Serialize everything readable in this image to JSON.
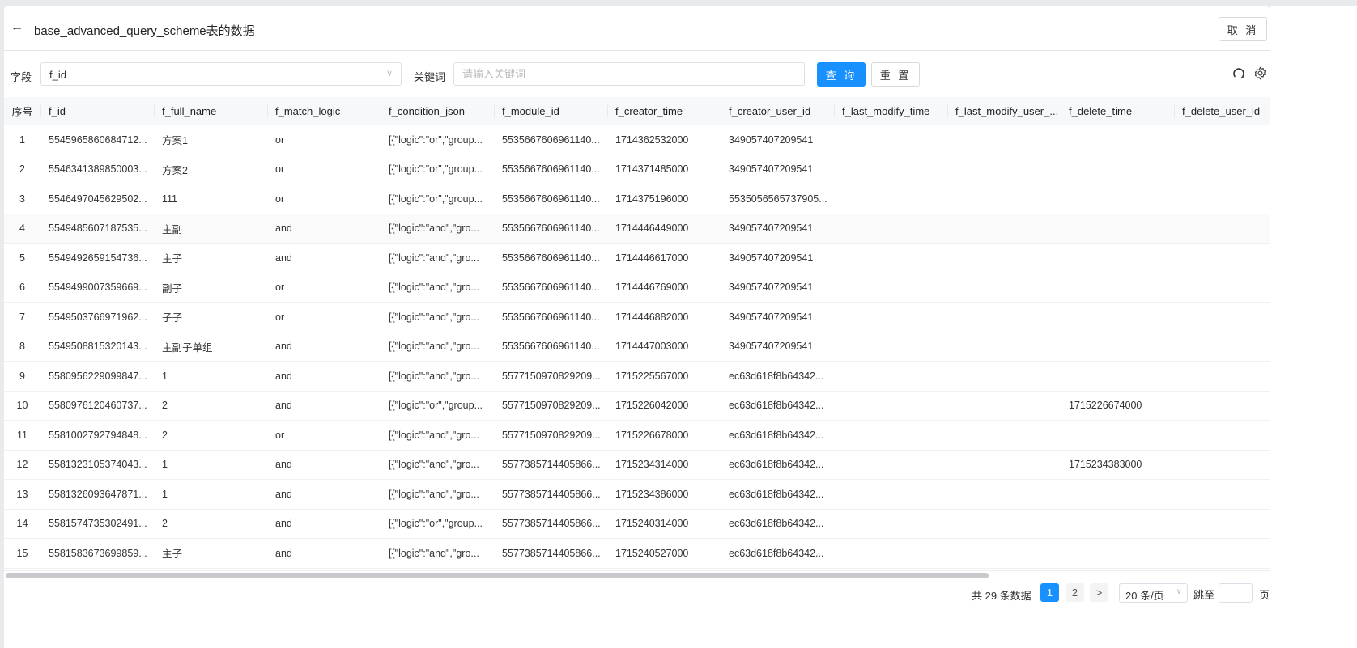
{
  "header": {
    "title": "base_advanced_query_scheme表的数据",
    "cancel_label": "取 消"
  },
  "filter": {
    "field_label": "字段",
    "field_value": "f_id",
    "keyword_label": "关键词",
    "keyword_placeholder": "请输入关键词",
    "keyword_value": "",
    "query_label": "查 询",
    "reset_label": "重 置"
  },
  "colors": {
    "primary": "#1890ff",
    "header_bg": "#f7f8fa"
  },
  "table": {
    "columns": [
      "序号",
      "f_id",
      "f_full_name",
      "f_match_logic",
      "f_condition_json",
      "f_module_id",
      "f_creator_time",
      "f_creator_user_id",
      "f_last_modify_time",
      "f_last_modify_user_...",
      "f_delete_time",
      "f_delete_user_id"
    ],
    "rows": [
      [
        "1",
        "5545965860684712...",
        "方案1",
        "or",
        "[{\"logic\":\"or\",\"group...",
        "5535667606961140...",
        "1714362532000",
        "349057407209541",
        "",
        "",
        "",
        ""
      ],
      [
        "2",
        "5546341389850003...",
        "方案2",
        "or",
        "[{\"logic\":\"or\",\"group...",
        "5535667606961140...",
        "1714371485000",
        "349057407209541",
        "",
        "",
        "",
        ""
      ],
      [
        "3",
        "5546497045629502...",
        "111",
        "or",
        "[{\"logic\":\"or\",\"group...",
        "5535667606961140...",
        "1714375196000",
        "5535056565737905...",
        "",
        "",
        "",
        ""
      ],
      [
        "4",
        "5549485607187535...",
        "主副",
        "and",
        "[{\"logic\":\"and\",\"gro...",
        "5535667606961140...",
        "1714446449000",
        "349057407209541",
        "",
        "",
        "",
        ""
      ],
      [
        "5",
        "5549492659154736...",
        "主子",
        "and",
        "[{\"logic\":\"and\",\"gro...",
        "5535667606961140...",
        "1714446617000",
        "349057407209541",
        "",
        "",
        "",
        ""
      ],
      [
        "6",
        "5549499007359669...",
        "副子",
        "or",
        "[{\"logic\":\"and\",\"gro...",
        "5535667606961140...",
        "1714446769000",
        "349057407209541",
        "",
        "",
        "",
        ""
      ],
      [
        "7",
        "5549503766971962...",
        "子子",
        "or",
        "[{\"logic\":\"and\",\"gro...",
        "5535667606961140...",
        "1714446882000",
        "349057407209541",
        "",
        "",
        "",
        ""
      ],
      [
        "8",
        "5549508815320143...",
        "主副子单组",
        "and",
        "[{\"logic\":\"and\",\"gro...",
        "5535667606961140...",
        "1714447003000",
        "349057407209541",
        "",
        "",
        "",
        ""
      ],
      [
        "9",
        "5580956229099847...",
        "1",
        "and",
        "[{\"logic\":\"and\",\"gro...",
        "5577150970829209...",
        "1715225567000",
        "ec63d618f8b64342...",
        "",
        "",
        "",
        ""
      ],
      [
        "10",
        "5580976120460737...",
        "2",
        "and",
        "[{\"logic\":\"or\",\"group...",
        "5577150970829209...",
        "1715226042000",
        "ec63d618f8b64342...",
        "",
        "",
        "1715226674000",
        ""
      ],
      [
        "11",
        "5581002792794848...",
        "2",
        "or",
        "[{\"logic\":\"and\",\"gro...",
        "5577150970829209...",
        "1715226678000",
        "ec63d618f8b64342...",
        "",
        "",
        "",
        ""
      ],
      [
        "12",
        "5581323105374043...",
        "1",
        "and",
        "[{\"logic\":\"and\",\"gro...",
        "5577385714405866...",
        "1715234314000",
        "ec63d618f8b64342...",
        "",
        "",
        "1715234383000",
        ""
      ],
      [
        "13",
        "5581326093647871...",
        "1",
        "and",
        "[{\"logic\":\"and\",\"gro...",
        "5577385714405866...",
        "1715234386000",
        "ec63d618f8b64342...",
        "",
        "",
        "",
        ""
      ],
      [
        "14",
        "5581574735302491...",
        "2",
        "and",
        "[{\"logic\":\"or\",\"group...",
        "5577385714405866...",
        "1715240314000",
        "ec63d618f8b64342...",
        "",
        "",
        "",
        ""
      ],
      [
        "15",
        "5581583673699859...",
        "主子",
        "and",
        "[{\"logic\":\"and\",\"gro...",
        "5577385714405866...",
        "1715240527000",
        "ec63d618f8b64342...",
        "",
        "",
        "",
        ""
      ]
    ]
  },
  "pagination": {
    "total_text": "共 29 条数据",
    "pages": [
      "1",
      "2"
    ],
    "current_page": 1,
    "next": ">",
    "page_size": "20 条/页",
    "jump_label": "跳至",
    "page_suffix": "页"
  }
}
